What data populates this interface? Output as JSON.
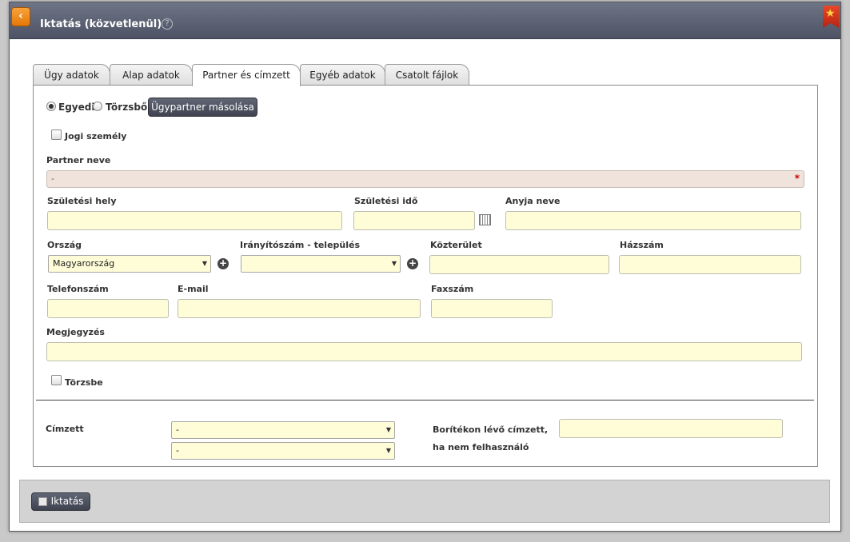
{
  "window": {
    "title": "Iktatás (közvetlenül)",
    "back_icon": "‹",
    "help_icon": "?"
  },
  "tabs": [
    {
      "label": "Ügy adatok",
      "active": false
    },
    {
      "label": "Alap adatok",
      "active": false
    },
    {
      "label": "Partner és címzett",
      "active": true
    },
    {
      "label": "Egyéb adatok",
      "active": false
    },
    {
      "label": "Csatolt fájlok",
      "active": false
    }
  ],
  "partner": {
    "radio_individual": "Egyedi",
    "radio_registry": "Törzsből",
    "copy_button": "Ügypartner másolása",
    "legal_entity": "Jogi személy",
    "partner_name_label": "Partner neve",
    "partner_name_value": "-",
    "required_mark": "*",
    "birth_place_label": "Születési hely",
    "birth_date_label": "Születési idő",
    "mother_name_label": "Anyja neve",
    "country_label": "Ország",
    "country_value": "Magyarország",
    "zip_label": "Irányítószám - település",
    "public_space_label": "Közterület",
    "house_number_label": "Házszám",
    "phone_label": "Telefonszám",
    "email_label": "E-mail",
    "fax_label": "Faxszám",
    "note_label": "Megjegyzés",
    "save_to_registry": "Törzsbe"
  },
  "recipient": {
    "label": "Címzett",
    "select1_value": "-",
    "select2_value": "-",
    "envelope_label": "Borítékon lévő címzett, ha nem felhasználó"
  },
  "footer": {
    "submit_button": "Iktatás"
  }
}
